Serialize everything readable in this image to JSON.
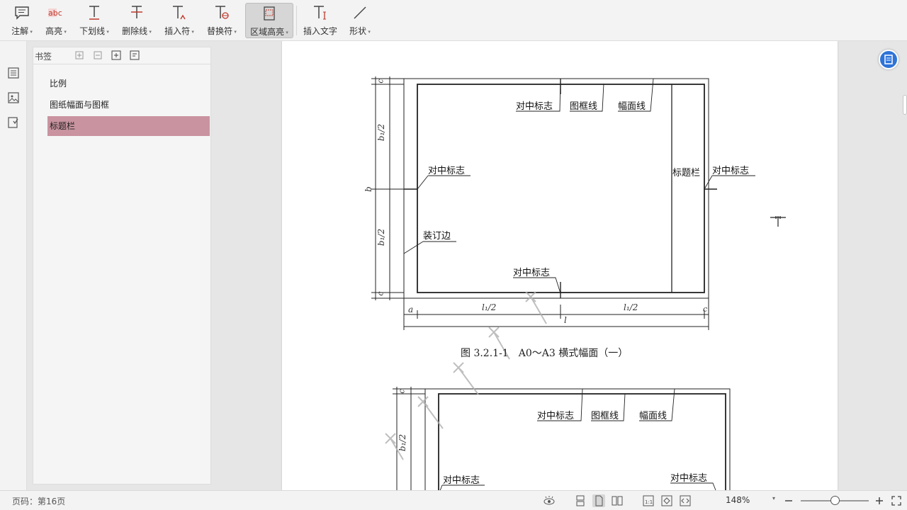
{
  "toolbar": {
    "items": [
      {
        "label": "注解",
        "icon": "comment-icon"
      },
      {
        "label": "高亮",
        "icon": "highlight-abc-icon"
      },
      {
        "label": "下划线",
        "icon": "underline-icon"
      },
      {
        "label": "删除线",
        "icon": "strikethrough-icon"
      },
      {
        "label": "插入符",
        "icon": "insert-caret-icon"
      },
      {
        "label": "替换符",
        "icon": "replace-icon"
      },
      {
        "label": "区域高亮",
        "icon": "area-highlight-icon"
      },
      {
        "label": "插入文字",
        "icon": "insert-text-icon"
      },
      {
        "label": "形状",
        "icon": "shape-line-icon"
      }
    ]
  },
  "bookmarks": {
    "title": "书签",
    "items": [
      "比例",
      "图纸幅面与图框",
      "标题栏"
    ],
    "selected_index": 2
  },
  "drawing1": {
    "lbl_center_mark": "对中标志",
    "lbl_frame_line": "图框线",
    "lbl_sheet_line": "幅面线",
    "lbl_title_block": "标题栏",
    "lbl_binding_edge": "装订边",
    "dim_c": "c",
    "dim_b1_half": "b₁/2",
    "dim_b": "b",
    "dim_a": "a",
    "dim_l1_half": "l₁/2",
    "dim_l": "l",
    "caption": "图 3.2.1-1　A0～A3 横式幅面（一）"
  },
  "drawing2": {
    "lbl_center_mark": "对中标志",
    "lbl_frame_line": "图框线",
    "lbl_sheet_line": "幅面线",
    "dim_c": "c",
    "dim_b1_half": "b₁/2"
  },
  "status": {
    "page_text": "页码：第16页",
    "zoom": "148%"
  },
  "colors": {
    "selection": "#c9939f",
    "accent": "#2e73d8",
    "toolbar_bg": "#f3f3f3"
  }
}
